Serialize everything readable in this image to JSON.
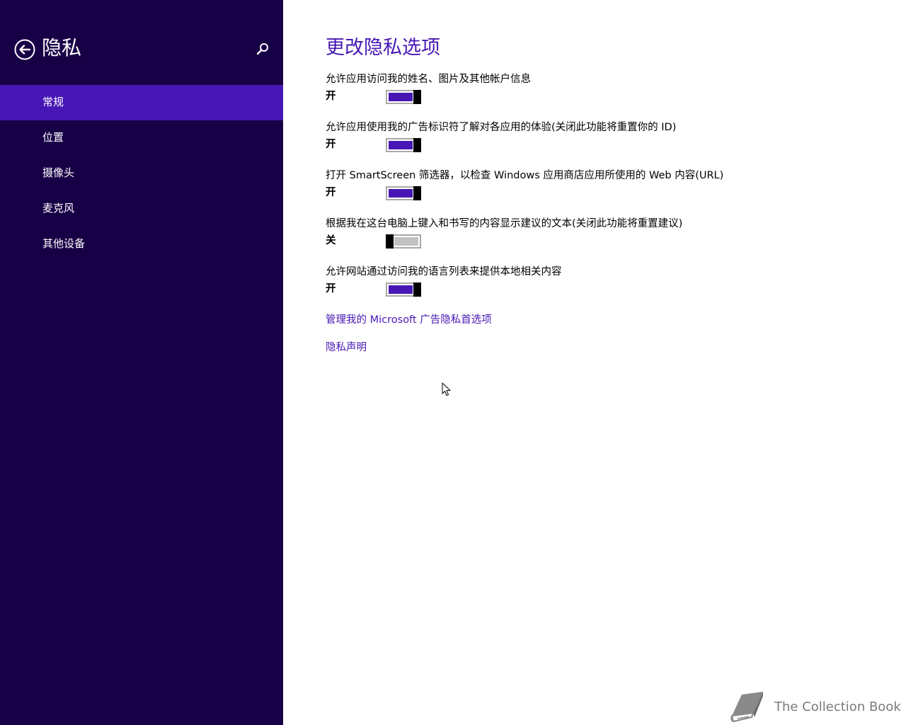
{
  "sidebar": {
    "title": "隐私",
    "back_icon": "back-arrow-icon",
    "search_icon": "search-icon",
    "items": [
      {
        "label": "常规",
        "active": true
      },
      {
        "label": "位置",
        "active": false
      },
      {
        "label": "摄像头",
        "active": false
      },
      {
        "label": "麦克风",
        "active": false
      },
      {
        "label": "其他设备",
        "active": false
      }
    ]
  },
  "main": {
    "title": "更改隐私选项",
    "settings": [
      {
        "label": "允许应用访问我的姓名、图片及其他帐户信息",
        "state": "开",
        "on": true
      },
      {
        "label": "允许应用使用我的广告标识符了解对各应用的体验(关闭此功能将重置你的 ID)",
        "state": "开",
        "on": true
      },
      {
        "label": "打开 SmartScreen 筛选器，以检查 Windows 应用商店应用所使用的 Web 内容(URL)",
        "state": "开",
        "on": true
      },
      {
        "label": "根据我在这台电脑上键入和书写的内容显示建议的文本(关闭此功能将重置建议)",
        "state": "关",
        "on": false
      },
      {
        "label": "允许网站通过访问我的语言列表来提供本地相关内容",
        "state": "开",
        "on": true
      }
    ],
    "links": {
      "ads_preferences": "管理我的 Microsoft 广告隐私首选项",
      "privacy_statement": "隐私声明"
    }
  },
  "watermark": {
    "text": "The Collection Book",
    "icon": "book-icon"
  },
  "colors": {
    "sidebar_bg": "#180046",
    "accent": "#4617b4",
    "toggle_off": "#c2c2c2"
  }
}
